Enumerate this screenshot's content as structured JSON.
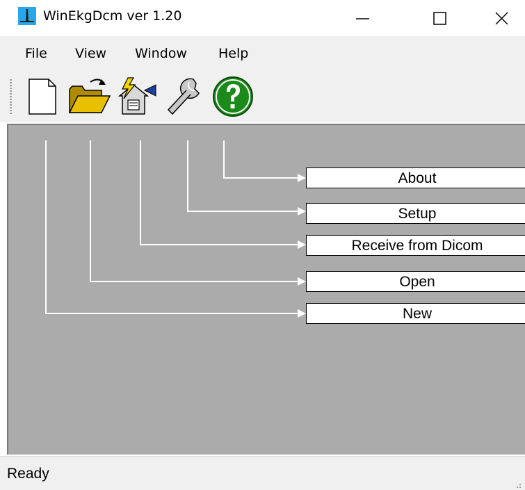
{
  "window": {
    "title": "WinEkgDcm ver 1.20",
    "icon": "ekg-app-icon",
    "controls": [
      "minimize-icon",
      "maximize-icon",
      "close-icon"
    ]
  },
  "menu": {
    "file": "File",
    "view": "View",
    "window": "Window",
    "help": "Help"
  },
  "toolbar": {
    "buttons": [
      {
        "icon": "new-document-icon"
      },
      {
        "icon": "open-folder-icon"
      },
      {
        "icon": "receive-dicom-icon"
      },
      {
        "icon": "wrench-setup-icon"
      },
      {
        "icon": "help-question-icon"
      }
    ]
  },
  "callouts": {
    "about": "About",
    "setup": "Setup",
    "receive": "Receive from Dicom",
    "open": "Open",
    "new": "New"
  },
  "status": {
    "text": "Ready"
  },
  "colors": {
    "client_bg": "#ababab",
    "chrome_bg": "#f0f0f0",
    "help_green": "#1a8a1a",
    "folder_yellow": "#e8c000"
  }
}
